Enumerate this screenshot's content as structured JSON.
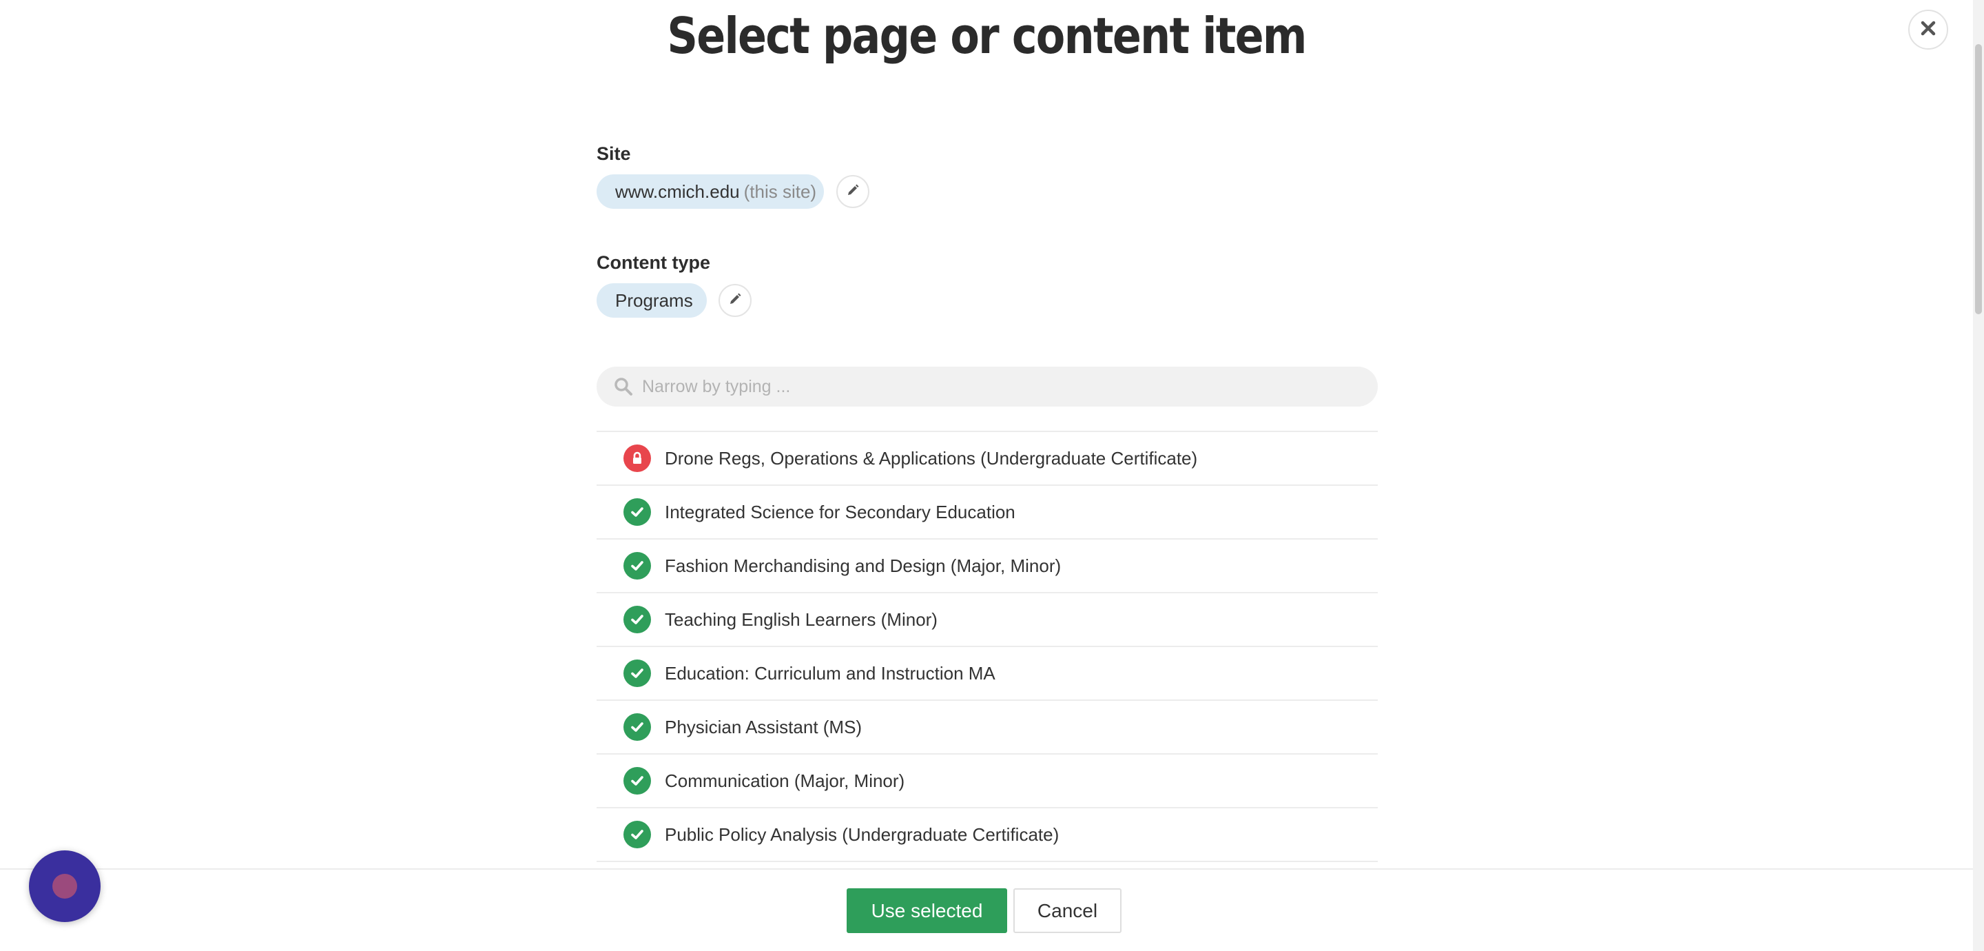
{
  "dialog": {
    "title": "Select page or content item"
  },
  "site": {
    "label": "Site",
    "value": "www.cmich.edu",
    "note": "(this site)"
  },
  "content_type": {
    "label": "Content type",
    "value": "Programs"
  },
  "search": {
    "placeholder": "Narrow by typing ..."
  },
  "items": [
    {
      "label": "Drone Regs, Operations & Applications (Undergraduate Certificate)",
      "status": "locked",
      "icon": "lock-icon"
    },
    {
      "label": "Integrated Science for Secondary Education",
      "status": "published",
      "icon": "check-icon"
    },
    {
      "label": "Fashion Merchandising and Design (Major, Minor)",
      "status": "published",
      "icon": "check-icon"
    },
    {
      "label": "Teaching English Learners (Minor)",
      "status": "published",
      "icon": "check-icon"
    },
    {
      "label": "Education: Curriculum and Instruction MA",
      "status": "published",
      "icon": "check-icon"
    },
    {
      "label": "Physician Assistant (MS)",
      "status": "published",
      "icon": "check-icon"
    },
    {
      "label": "Communication (Major, Minor)",
      "status": "published",
      "icon": "check-icon"
    },
    {
      "label": "Public Policy Analysis (Undergraduate Certificate)",
      "status": "published",
      "icon": "check-icon"
    }
  ],
  "footer": {
    "use_selected": "Use selected",
    "cancel": "Cancel"
  },
  "colors": {
    "primary": "#2e9e5a",
    "pill": "#dcebf5",
    "locked": "#e8454c",
    "chat": "#3a2f9e"
  }
}
